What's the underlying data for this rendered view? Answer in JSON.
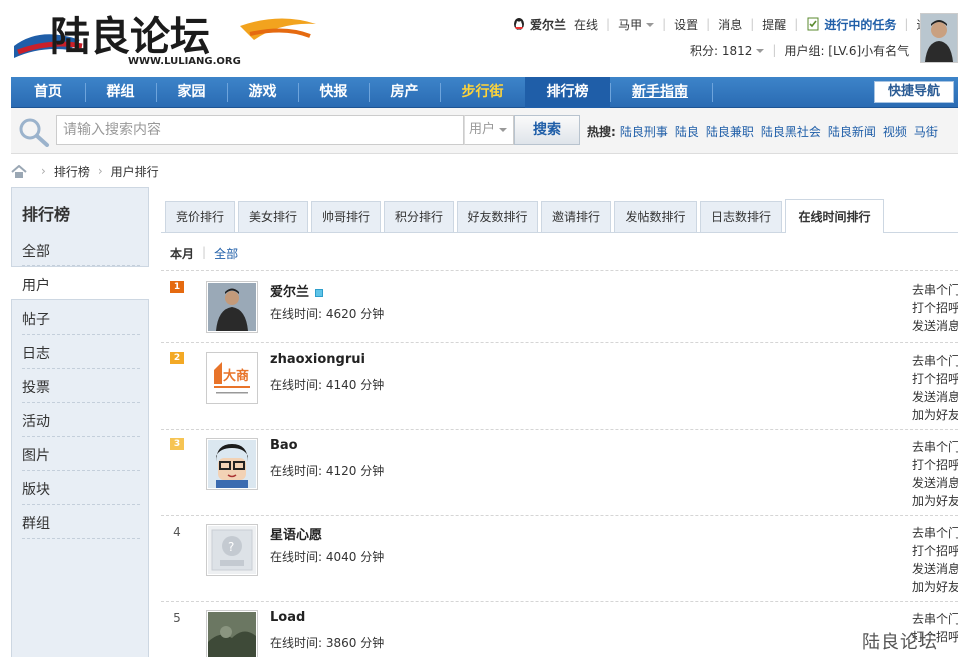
{
  "header": {
    "logo_text": "陆良论坛",
    "logo_url_text": "WWW.LULIANG.ORG",
    "username": "爱尔兰",
    "online_status": "在线",
    "links": [
      "马甲",
      "设置",
      "消息",
      "提醒"
    ],
    "task_link": "进行中的任务",
    "logout": "退出",
    "score": "积分: 1812",
    "usergroup": "用户组: [LV.6]小有名气"
  },
  "nav": {
    "items": [
      "首页",
      "群组",
      "家园",
      "游戏",
      "快报",
      "房产",
      "步行街",
      "排行榜",
      "新手指南"
    ],
    "quick_nav": "快捷导航"
  },
  "search": {
    "placeholder": "请输入搜索内容",
    "type": "用户",
    "button": "搜索",
    "hot_label": "热搜:",
    "hot_words": [
      "陆良刑事",
      "陆良",
      "陆良兼职",
      "陆良黑社会",
      "陆良新闻",
      "视频",
      "马街"
    ]
  },
  "breadcrumb": [
    "排行榜",
    "用户排行"
  ],
  "sidebar": {
    "title": "排行榜",
    "items": [
      "全部",
      "用户",
      "帖子",
      "日志",
      "投票",
      "活动",
      "图片",
      "版块",
      "群组"
    ]
  },
  "tabs": [
    "竞价排行",
    "美女排行",
    "帅哥排行",
    "积分排行",
    "好友数排行",
    "邀请排行",
    "发帖数排行",
    "日志数排行",
    "在线时间排行"
  ],
  "filter": {
    "current": "本月",
    "other": "全部"
  },
  "rows": [
    {
      "rank": "1",
      "name": "爱尔兰",
      "time": "在线时间: 4620 分钟",
      "actions": [
        "去串个门",
        "打个招呼",
        "发送消息"
      ]
    },
    {
      "rank": "2",
      "name": "zhaoxiongrui",
      "time": "在线时间: 4140 分钟",
      "actions": [
        "去串个门",
        "打个招呼",
        "发送消息",
        "加为好友"
      ]
    },
    {
      "rank": "3",
      "name": "Bao",
      "time": "在线时间: 4120 分钟",
      "actions": [
        "去串个门",
        "打个招呼",
        "发送消息",
        "加为好友"
      ]
    },
    {
      "rank": "4",
      "name": "星语心愿",
      "time": "在线时间: 4040 分钟",
      "actions": [
        "去串个门",
        "打个招呼",
        "发送消息",
        "加为好友"
      ]
    },
    {
      "rank": "5",
      "name": "Load",
      "time": "在线时间: 3860 分钟",
      "actions": [
        "去串个门",
        "打个招呼"
      ]
    }
  ],
  "watermark": "陆良论坛",
  "colors": {
    "nav_blue": "#2a6bb3",
    "nav_active": "#1f5ea8",
    "link_blue": "#1f5ea8",
    "highlight_yellow": "#ffd43a"
  }
}
